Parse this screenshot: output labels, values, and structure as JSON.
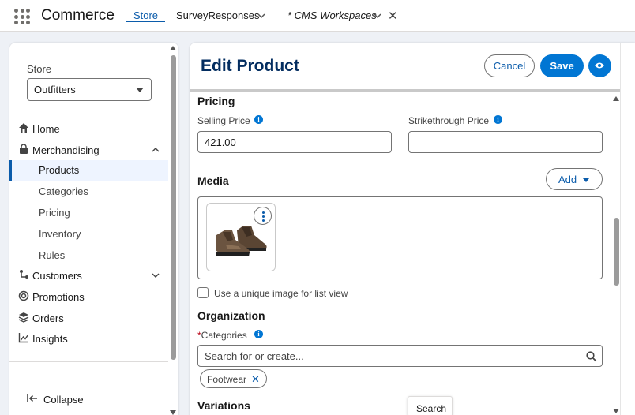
{
  "app": {
    "name": "Commerce"
  },
  "tabs": [
    {
      "label": "Store",
      "active": true
    },
    {
      "label": "SurveyResponses"
    },
    {
      "label": "* CMS Workspaces"
    }
  ],
  "sidebar": {
    "store_label": "Store",
    "store_value": "Outfitters",
    "items": [
      {
        "label": "Home",
        "icon": "home-icon"
      },
      {
        "label": "Merchandising",
        "icon": "bag-icon",
        "expanded": true
      },
      {
        "label": "Products",
        "active": true
      },
      {
        "label": "Categories"
      },
      {
        "label": "Pricing"
      },
      {
        "label": "Inventory"
      },
      {
        "label": "Rules"
      },
      {
        "label": "Customers",
        "icon": "customers-icon"
      },
      {
        "label": "Promotions",
        "icon": "promotions-icon"
      },
      {
        "label": "Orders",
        "icon": "orders-icon"
      },
      {
        "label": "Insights",
        "icon": "insights-icon"
      }
    ],
    "collapse_label": "Collapse"
  },
  "page": {
    "title": "Edit Product",
    "cancel_label": "Cancel",
    "save_label": "Save",
    "pricing": {
      "title": "Pricing",
      "selling_price_label": "Selling Price",
      "selling_price_value": "421.00",
      "strikethrough_label": "Strikethrough Price",
      "strikethrough_value": ""
    },
    "media": {
      "title": "Media",
      "add_label": "Add",
      "unique_image_label": "Use a unique image for list view",
      "unique_image_checked": false
    },
    "organization": {
      "title": "Organization",
      "required_marker": "*",
      "categories_label": "Categories",
      "search_placeholder": "Search for or create...",
      "selected_category": "Footwear"
    },
    "variations_title": "Variations",
    "tooltip": "Search"
  },
  "colors": {
    "brand_blue": "#0176d3",
    "link_blue": "#0b5cab",
    "title_navy": "#032d60"
  }
}
